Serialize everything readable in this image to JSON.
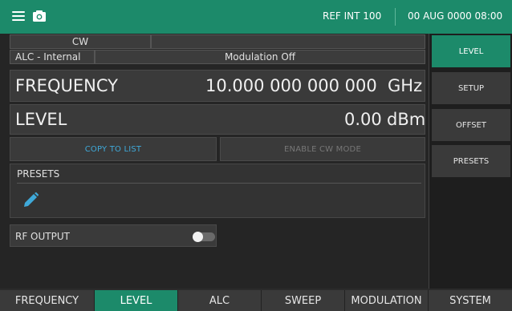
{
  "header": {
    "menu_icon": "hamburger-menu-icon",
    "camera_icon": "camera-icon",
    "reference": "REF INT 100",
    "datetime": "00 AUG 0000 08:00",
    "accent_color": "#1c8a6a"
  },
  "status": {
    "mode": "CW",
    "alc": "ALC - Internal",
    "modulation": "Modulation Off"
  },
  "frequency": {
    "label": "FREQUENCY",
    "value": "10.000 000 000 000",
    "unit": "GHz"
  },
  "level": {
    "label": "LEVEL",
    "value": "0.00",
    "unit": "dBm"
  },
  "actions": {
    "copy_to_list": "COPY TO LIST",
    "enable_cw_mode": "ENABLE CW MODE"
  },
  "presets": {
    "title": "PRESETS",
    "edit_icon": "pencil-icon"
  },
  "rf_output": {
    "label": "RF OUTPUT",
    "enabled": false
  },
  "right_menu": {
    "items": [
      {
        "label": "LEVEL",
        "active": true
      },
      {
        "label": "SETUP",
        "active": false
      },
      {
        "label": "OFFSET",
        "active": false
      },
      {
        "label": "PRESETS",
        "active": false
      }
    ]
  },
  "bottom_tabs": {
    "items": [
      {
        "label": "FREQUENCY",
        "active": false
      },
      {
        "label": "LEVEL",
        "active": true
      },
      {
        "label": "ALC",
        "active": false
      },
      {
        "label": "SWEEP",
        "active": false
      },
      {
        "label": "MODULATION",
        "active": false
      },
      {
        "label": "SYSTEM",
        "active": false
      }
    ]
  }
}
